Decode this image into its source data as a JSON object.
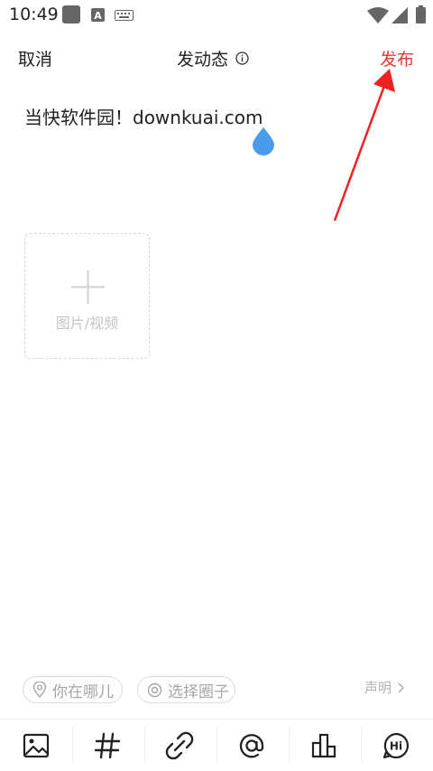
{
  "status_bar": {
    "time": "10:49",
    "icons": [
      "gallery-icon",
      "a-badge-icon",
      "keyboard-icon",
      "wifi-icon",
      "signal-icon",
      "battery-icon"
    ]
  },
  "header": {
    "cancel_label": "取消",
    "title": "发动态",
    "publish_label": "发布",
    "publish_color": "#e53935"
  },
  "editor": {
    "text": "当快软件园！downkuai.com",
    "cursor_color": "#4a9bea"
  },
  "media": {
    "label": "图片/视频"
  },
  "chips": {
    "location_label": "你在哪儿",
    "circle_label": "选择圈子"
  },
  "statement": {
    "label": "声明"
  },
  "toolbar": {
    "items": [
      "image-icon",
      "hashtag-icon",
      "link-icon",
      "mention-icon",
      "poll-icon",
      "hi-icon"
    ]
  },
  "annotation": {
    "arrow_color": "#ee2222"
  }
}
